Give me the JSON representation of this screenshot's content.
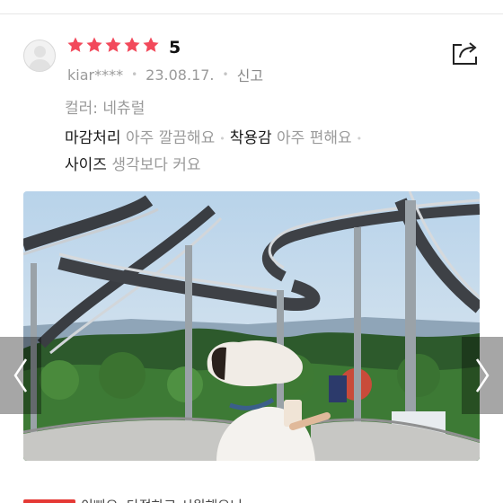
{
  "review": {
    "rating_value": 5,
    "rating_text": "5",
    "reviewer": "kiar****",
    "date": "23.08.17.",
    "report_label": "신고",
    "color_label": "컬러:",
    "color_value": "네츄럴",
    "finish_label": "마감처리",
    "finish_value": "아주 깔끔해요",
    "fit_label": "착용감",
    "fit_value": "아주 편해요",
    "size_label": "사이즈",
    "size_value": "생각보다 커요",
    "next_review_preview": "이뻐요. 단정하고 시원해요니…"
  },
  "icons": {
    "avatar": "default-user-icon",
    "star": "star-icon",
    "share": "share-icon",
    "prev": "chevron-left-icon",
    "next": "chevron-right-icon"
  },
  "colors": {
    "star": "#f2495b",
    "meta": "#9a9a9a",
    "badge": "#e53935"
  }
}
